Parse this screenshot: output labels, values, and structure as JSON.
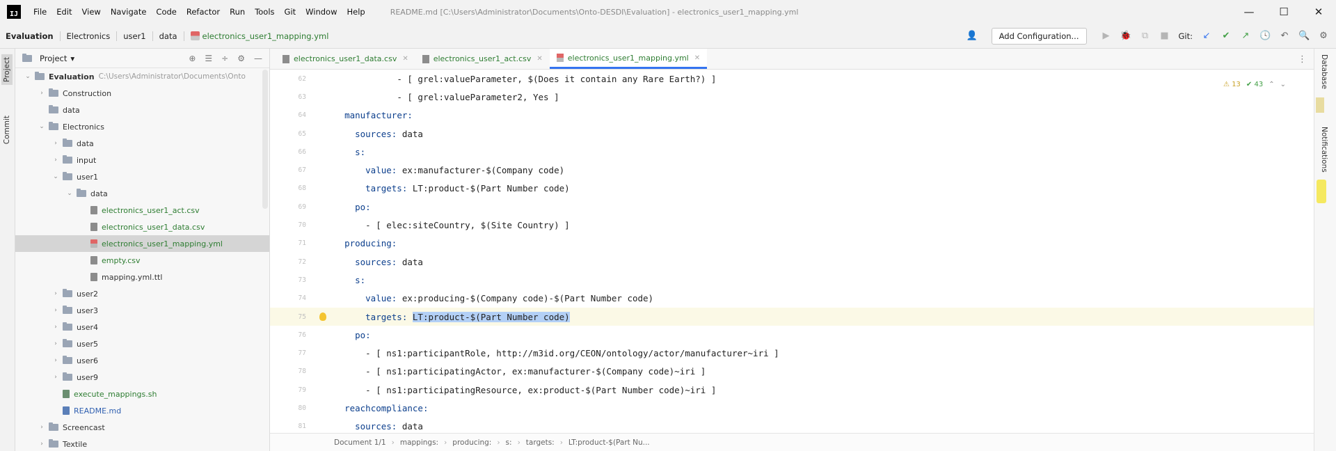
{
  "menubar": {
    "logo_text": "IJ",
    "items": [
      "File",
      "Edit",
      "View",
      "Navigate",
      "Code",
      "Refactor",
      "Run",
      "Tools",
      "Git",
      "Window",
      "Help"
    ],
    "window_title": "README.md [C:\\Users\\Administrator\\Documents\\Onto-DESDI\\Evaluation] - electronics_user1_mapping.yml",
    "minimize": "—",
    "maximize": "☐",
    "close": "✕"
  },
  "navbar": {
    "breadcrumbs": [
      "Evaluation",
      "Electronics",
      "user1",
      "data",
      "electronics_user1_mapping.yml"
    ],
    "add_configuration": "Add Configuration...",
    "git_label": "Git:"
  },
  "left_strip": {
    "project_tab": "Project",
    "commit_tab": "Commit"
  },
  "project_panel": {
    "title": "Project",
    "title_arrow": "▾",
    "tree": [
      {
        "label": "Evaluation",
        "path": "C:\\Users\\Administrator\\Documents\\Onto",
        "type": "folder",
        "depth": 0,
        "expanded": true,
        "bold": true
      },
      {
        "label": "Construction",
        "type": "folder",
        "depth": 1,
        "expanded": false
      },
      {
        "label": "data",
        "type": "folder",
        "depth": 1,
        "leaf": true
      },
      {
        "label": "Electronics",
        "type": "folder",
        "depth": 1,
        "expanded": true
      },
      {
        "label": "data",
        "type": "folder",
        "depth": 2,
        "expanded": false
      },
      {
        "label": "input",
        "type": "folder",
        "depth": 2,
        "expanded": false
      },
      {
        "label": "user1",
        "type": "folder",
        "depth": 2,
        "expanded": true
      },
      {
        "label": "data",
        "type": "folder",
        "depth": 3,
        "expanded": true
      },
      {
        "label": "electronics_user1_act.csv",
        "type": "file",
        "depth": 4,
        "color": "green"
      },
      {
        "label": "electronics_user1_data.csv",
        "type": "file",
        "depth": 4,
        "color": "green"
      },
      {
        "label": "electronics_user1_mapping.yml",
        "type": "yml",
        "depth": 4,
        "color": "green",
        "selected": true
      },
      {
        "label": "empty.csv",
        "type": "file",
        "depth": 4,
        "color": "green"
      },
      {
        "label": "mapping.yml.ttl",
        "type": "file",
        "depth": 4,
        "color": "gray"
      },
      {
        "label": "user2",
        "type": "folder",
        "depth": 2,
        "expanded": false
      },
      {
        "label": "user3",
        "type": "folder",
        "depth": 2,
        "expanded": false
      },
      {
        "label": "user4",
        "type": "folder",
        "depth": 2,
        "expanded": false
      },
      {
        "label": "user5",
        "type": "folder",
        "depth": 2,
        "expanded": false
      },
      {
        "label": "user6",
        "type": "folder",
        "depth": 2,
        "expanded": false
      },
      {
        "label": "user9",
        "type": "folder",
        "depth": 2,
        "expanded": false
      },
      {
        "label": "execute_mappings.sh",
        "type": "sh",
        "depth": 2,
        "color": "green"
      },
      {
        "label": "README.md",
        "type": "md",
        "depth": 2,
        "color": "blue"
      },
      {
        "label": "Screencast",
        "type": "folder",
        "depth": 1,
        "expanded": false
      },
      {
        "label": "Textile",
        "type": "folder",
        "depth": 1,
        "expanded": false
      }
    ]
  },
  "editor": {
    "tabs": [
      {
        "label": "electronics_user1_data.csv",
        "icon": "csv",
        "active": false
      },
      {
        "label": "electronics_user1_act.csv",
        "icon": "csv",
        "active": false
      },
      {
        "label": "electronics_user1_mapping.yml",
        "icon": "yml",
        "active": true
      }
    ],
    "inspections": {
      "warnings": "⚠ 13",
      "checks": "✔ 43"
    },
    "lines": [
      {
        "num": "62",
        "indent": 10,
        "prefix": "- [ ",
        "key": "",
        "text": "grel:valueParameter, $(Does it contain any Rare Earth?) ]"
      },
      {
        "num": "63",
        "indent": 10,
        "prefix": "- [ ",
        "key": "",
        "text": "grel:valueParameter2, Yes ]"
      },
      {
        "num": "64",
        "indent": 0,
        "prefix": "",
        "key": "manufacturer:",
        "text": ""
      },
      {
        "num": "65",
        "indent": 2,
        "prefix": "",
        "key": "sources:",
        "text": " data"
      },
      {
        "num": "66",
        "indent": 2,
        "prefix": "",
        "key": "s:",
        "text": ""
      },
      {
        "num": "67",
        "indent": 4,
        "prefix": "",
        "key": "value:",
        "text": " ex:manufacturer-$(Company code)"
      },
      {
        "num": "68",
        "indent": 4,
        "prefix": "",
        "key": "targets:",
        "text": " LT:product-$(Part Number code)"
      },
      {
        "num": "69",
        "indent": 2,
        "prefix": "",
        "key": "po:",
        "text": ""
      },
      {
        "num": "70",
        "indent": 4,
        "prefix": "- [ ",
        "key": "",
        "text": "elec:siteCountry, $(Site Country) ]"
      },
      {
        "num": "71",
        "indent": 0,
        "prefix": "",
        "key": "producing:",
        "text": ""
      },
      {
        "num": "72",
        "indent": 2,
        "prefix": "",
        "key": "sources:",
        "text": " data"
      },
      {
        "num": "73",
        "indent": 2,
        "prefix": "",
        "key": "s:",
        "text": ""
      },
      {
        "num": "74",
        "indent": 4,
        "prefix": "",
        "key": "value:",
        "text": " ex:producing-$(Company code)-$(Part Number code)"
      },
      {
        "num": "75",
        "indent": 4,
        "prefix": "",
        "key": "targets:",
        "text": " ",
        "selected": "LT:product-$(Part Number code)",
        "current": true,
        "bulb": true
      },
      {
        "num": "76",
        "indent": 2,
        "prefix": "",
        "key": "po:",
        "text": ""
      },
      {
        "num": "77",
        "indent": 4,
        "prefix": "- [ ",
        "key": "",
        "text": "ns1:participantRole, http://m3id.org/CEON/ontology/actor/manufacturer~iri ]"
      },
      {
        "num": "78",
        "indent": 4,
        "prefix": "- [ ",
        "key": "",
        "text": "ns1:participatingActor, ex:manufacturer-$(Company code)~iri ]"
      },
      {
        "num": "79",
        "indent": 4,
        "prefix": "- [ ",
        "key": "",
        "text": "ns1:participatingResource, ex:product-$(Part Number code)~iri ]"
      },
      {
        "num": "80",
        "indent": 0,
        "prefix": "",
        "key": "reachcompliance:",
        "text": ""
      },
      {
        "num": "81",
        "indent": 2,
        "prefix": "",
        "key": "sources:",
        "text": " data"
      }
    ],
    "status_crumbs": [
      "Document 1/1",
      "mappings:",
      "producing:",
      "s:",
      "targets:",
      "LT:product-$(Part Nu..."
    ]
  },
  "right_strip": {
    "database_tab": "Database",
    "notifications_tab": "Notifications"
  }
}
